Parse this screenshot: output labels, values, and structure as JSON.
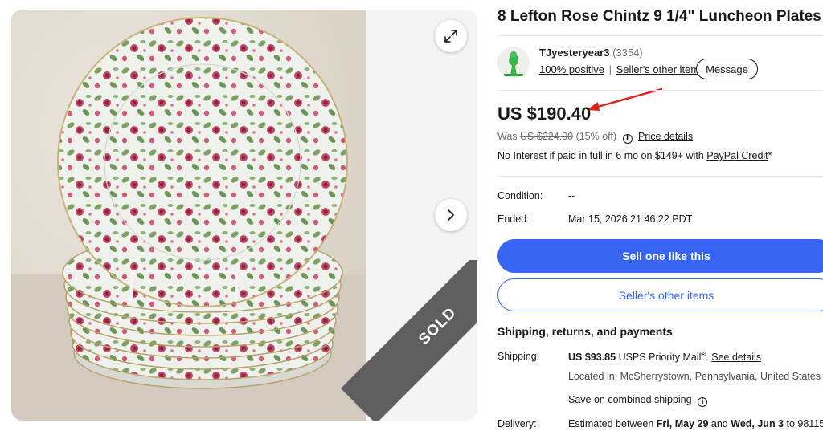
{
  "listing": {
    "title": "8 Lefton Rose Chintz 9 1/4\" Luncheon Plates",
    "sold_badge": "SOLD"
  },
  "seller": {
    "name": "TJyesteryear3",
    "feedback_count": "(3354)",
    "positive_link": "100% positive",
    "other_items_link": "Seller's other items",
    "message_button": "Message"
  },
  "pricing": {
    "price": "US $190.40",
    "was_label": "Was",
    "was_price": "US $224.00",
    "discount": "(15% off)",
    "price_details_link": "Price details",
    "credit_text": "No Interest if paid in full in 6 mo on $149+ with",
    "credit_link": "PayPal Credit",
    "credit_suffix": "*"
  },
  "details": {
    "condition_label": "Condition:",
    "condition_value": "--",
    "ended_label": "Ended:",
    "ended_value": "Mar 15, 2026 21:46:22 PDT"
  },
  "actions": {
    "sell_one_label": "Sell one like this",
    "seller_items_label": "Seller's other items"
  },
  "shipping": {
    "section_title": "Shipping, returns, and payments",
    "shipping_label": "Shipping:",
    "shipping_price": "US $93.85",
    "shipping_service": "USPS Priority Mail",
    "registered_mark": "®",
    "punctuation": ".",
    "see_details_link": "See details",
    "location": "Located in: McSherrystown, Pennsylvania, United States",
    "combined_shipping": "Save on combined shipping",
    "delivery_label": "Delivery:",
    "delivery_prefix": "Estimated between",
    "delivery_start": "Fri, May 29",
    "delivery_and": "and",
    "delivery_end": "Wed, Jun 3",
    "delivery_to": "to 98115"
  },
  "colors": {
    "accent_blue": "#3665f3",
    "annotation_red": "#e0201c",
    "sold_ribbon": "#5f5f5f"
  },
  "icons": [
    "expand-icon",
    "chevron-right-icon",
    "info-icon",
    "seller-avatar-image"
  ]
}
